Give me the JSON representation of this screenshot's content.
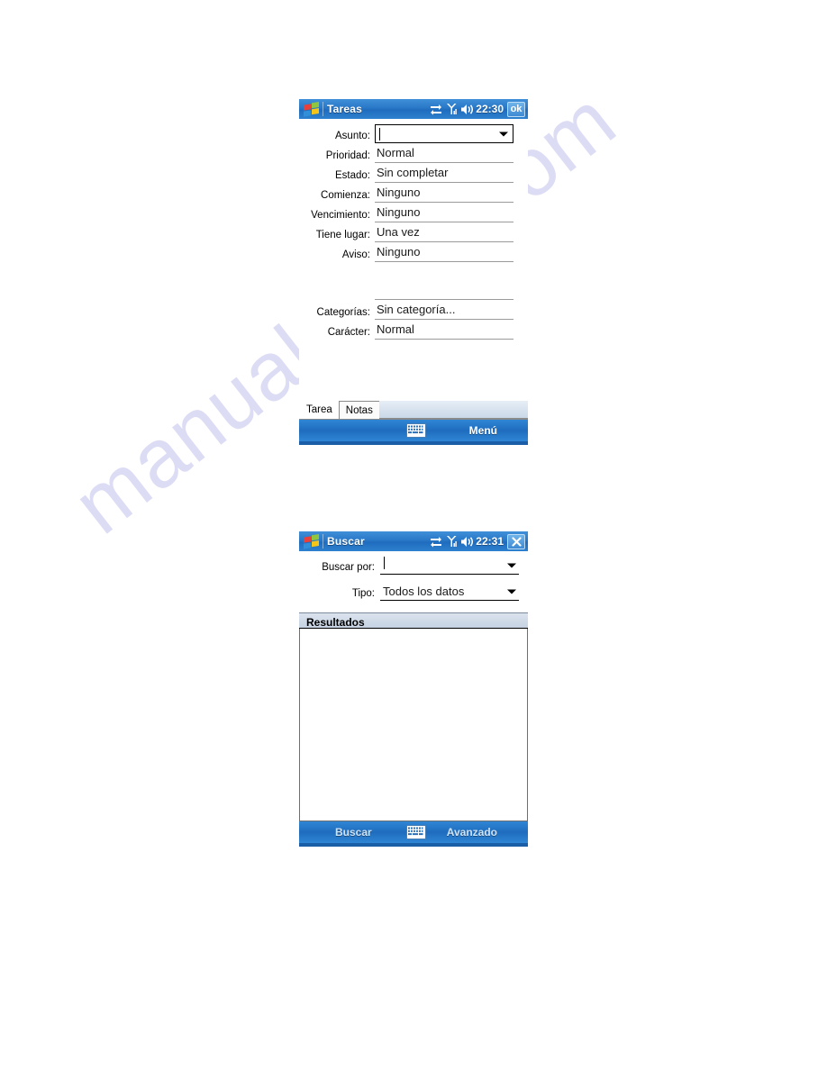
{
  "watermark": {
    "text": "manualshive.com",
    "color": "#dcdcf5"
  },
  "theme": {
    "titlebar_blue": "#2878c8",
    "toolbar_blue": "#1f6cbe",
    "results_header_bg": "#cfd9e8"
  },
  "windows": [
    {
      "id": "tareas",
      "titlebar": {
        "logo_icon": "windows-flag-icon",
        "title": "Tareas",
        "status_icons": [
          "connectivity-arrows-icon",
          "signal-bars-icon",
          "speaker-icon"
        ],
        "clock": "22:30",
        "action_button_label": "ok",
        "action_button_icon": "ok-button"
      },
      "fields": [
        {
          "label": "Asunto:",
          "value": "",
          "type": "combo",
          "has_caret": true,
          "has_arrow": true
        },
        {
          "label": "Prioridad:",
          "value": "Normal",
          "type": "line"
        },
        {
          "label": "Estado:",
          "value": "Sin completar",
          "type": "line"
        },
        {
          "label": "Comienza:",
          "value": "Ninguno",
          "type": "line"
        },
        {
          "label": "Vencimiento:",
          "value": "Ninguno",
          "type": "line"
        },
        {
          "label": "Tiene lugar:",
          "value": "Una vez",
          "type": "line"
        },
        {
          "label": "Aviso:",
          "value": "Ninguno",
          "type": "line"
        },
        {
          "label": "",
          "value": "",
          "type": "line-empty"
        },
        {
          "label": "Categorías:",
          "value": "Sin categoría...",
          "type": "line"
        },
        {
          "label": "Carácter:",
          "value": "Normal",
          "type": "line"
        }
      ],
      "tabs": [
        {
          "label": "Tarea",
          "active": true
        },
        {
          "label": "Notas",
          "active": false
        }
      ],
      "toolbar": {
        "left_label": "",
        "center_icon": "keyboard-sip-icon",
        "right_label": "Menú"
      }
    },
    {
      "id": "buscar",
      "titlebar": {
        "logo_icon": "windows-flag-icon",
        "title": "Buscar",
        "status_icons": [
          "connectivity-arrows-icon",
          "signal-bars-icon",
          "speaker-icon"
        ],
        "clock": "22:31",
        "action_button_label": "",
        "action_button_icon": "close-icon"
      },
      "fields": [
        {
          "label": "Buscar por:",
          "value": "",
          "has_caret": true,
          "has_arrow": true
        },
        {
          "label": "Tipo:",
          "value": "Todos los datos",
          "has_caret": false,
          "has_arrow": true
        }
      ],
      "results": {
        "header": "Resultados",
        "items": []
      },
      "toolbar": {
        "left_label": "Buscar",
        "center_icon": "keyboard-sip-icon",
        "right_label": "Avanzado"
      }
    }
  ]
}
